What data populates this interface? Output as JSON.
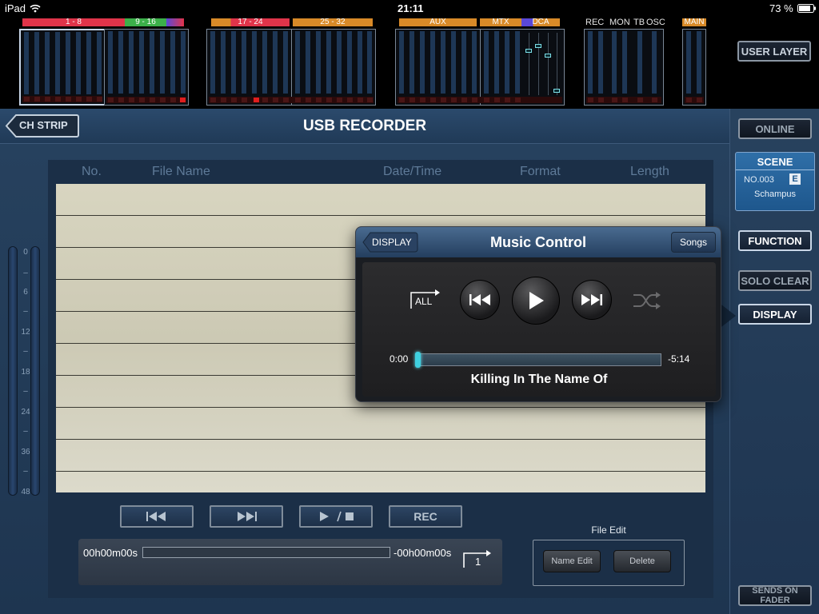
{
  "status_bar": {
    "device": "iPad",
    "time": "21:11",
    "battery": "73 %"
  },
  "meter_bridge": {
    "tags": {
      "ch1": "1 - 8",
      "ch9": "9 - 16",
      "ch17": "17 - 24",
      "ch25": "25 - 32",
      "aux": "AUX",
      "mtx": "MTX",
      "dca": "DCA",
      "main": "MAIN"
    },
    "labels": {
      "rec": "REC",
      "mon": "MON",
      "tb": "TB",
      "osc": "OSC"
    },
    "user_layer": "USER LAYER",
    "colors": {
      "ch1": "#e0344a",
      "ch9": "#3cb04a",
      "ch17": "#d88a28",
      "ch25": "#d88a28",
      "aux": "#d88a28",
      "mtx": "#d88a28",
      "dca": "#5a48d8",
      "main": "#d88a28"
    }
  },
  "header": {
    "back": "CH STRIP",
    "title": "USB RECORDER"
  },
  "table": {
    "col_no": "No.",
    "col_file": "File Name",
    "col_date": "Date/Time",
    "col_format": "Format",
    "col_length": "Length"
  },
  "level_meter": {
    "ticks": [
      "0",
      "6",
      "12",
      "18",
      "24",
      "36",
      "48"
    ]
  },
  "transport": {
    "rec": "REC",
    "elapsed": "00h00m00s",
    "remaining": "-00h00m00s",
    "repeat_count": "1"
  },
  "file_edit": {
    "label": "File Edit",
    "name_edit": "Name Edit",
    "delete": "Delete"
  },
  "right_panel": {
    "online": "ONLINE",
    "scene": {
      "title": "SCENE",
      "number": "NO.003",
      "badge": "E",
      "name": "Schampus"
    },
    "function": "FUNCTION",
    "solo_clear": "SOLO CLEAR",
    "display": "DISPLAY",
    "sends_on_fader": "SENDS ON FADER"
  },
  "music_control": {
    "display": "DISPLAY",
    "title": "Music Control",
    "songs": "Songs",
    "repeat_mode": "ALL",
    "elapsed": "0:00",
    "remaining": "-5:14",
    "progress": 0,
    "track": "Killing In The Name Of"
  }
}
